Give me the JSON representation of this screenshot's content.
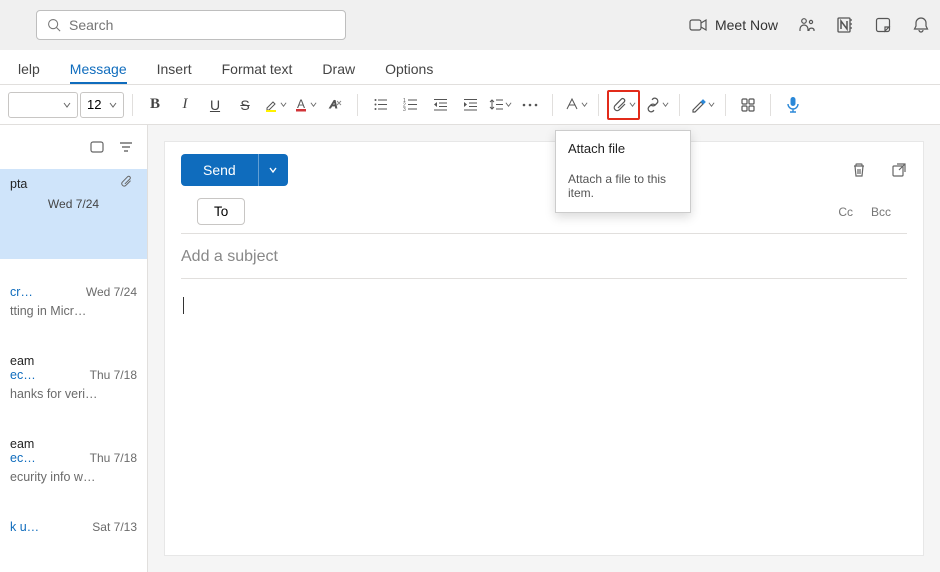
{
  "titlebar": {
    "search_placeholder": "Search",
    "meet_now": "Meet Now"
  },
  "tabs": [
    {
      "label": "lelp"
    },
    {
      "label": "Message"
    },
    {
      "label": "Insert"
    },
    {
      "label": "Format text"
    },
    {
      "label": "Draw"
    },
    {
      "label": "Options"
    }
  ],
  "ribbon": {
    "font_size": "12",
    "tooltip_title": "Attach file",
    "tooltip_body": "Attach a file to this item."
  },
  "compose": {
    "send": "Send",
    "to": "To",
    "cc": "Cc",
    "bcc": "Bcc",
    "subject_placeholder": "Add a subject"
  },
  "messages": [
    {
      "from": "pta",
      "date": "Wed 7/24",
      "selected": true
    },
    {
      "link": "cr…",
      "date": "Wed 7/24",
      "preview": "tting in Micr…"
    },
    {
      "from": "eam",
      "link2": "ec…",
      "date": "Thu 7/18",
      "preview": "hanks for veri…"
    },
    {
      "from": "eam",
      "link2": "ec…",
      "date": "Thu 7/18",
      "preview": "ecurity info w…"
    },
    {
      "link": "k u…",
      "date": "Sat 7/13",
      "preview": ""
    }
  ]
}
